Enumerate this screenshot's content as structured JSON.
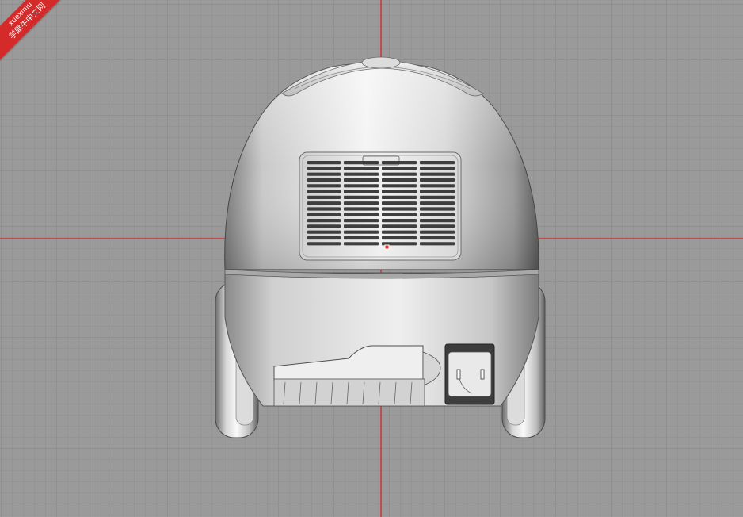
{
  "viewport": {
    "background_color": "#9a9a9a",
    "grid_minor_color": "#8d8d8d",
    "grid_major_color": "#858585",
    "axis_color": "#d21f1f"
  },
  "watermark": {
    "line1": "xuexiniu",
    "line2": "学犀牛中文网",
    "color": "#d42a2a"
  },
  "model": {
    "object_name": "vacuum-cleaner",
    "body_color": "#d9d9d9",
    "grille_slot_color": "#3e3e3e",
    "indicator_color": "#e53030"
  }
}
